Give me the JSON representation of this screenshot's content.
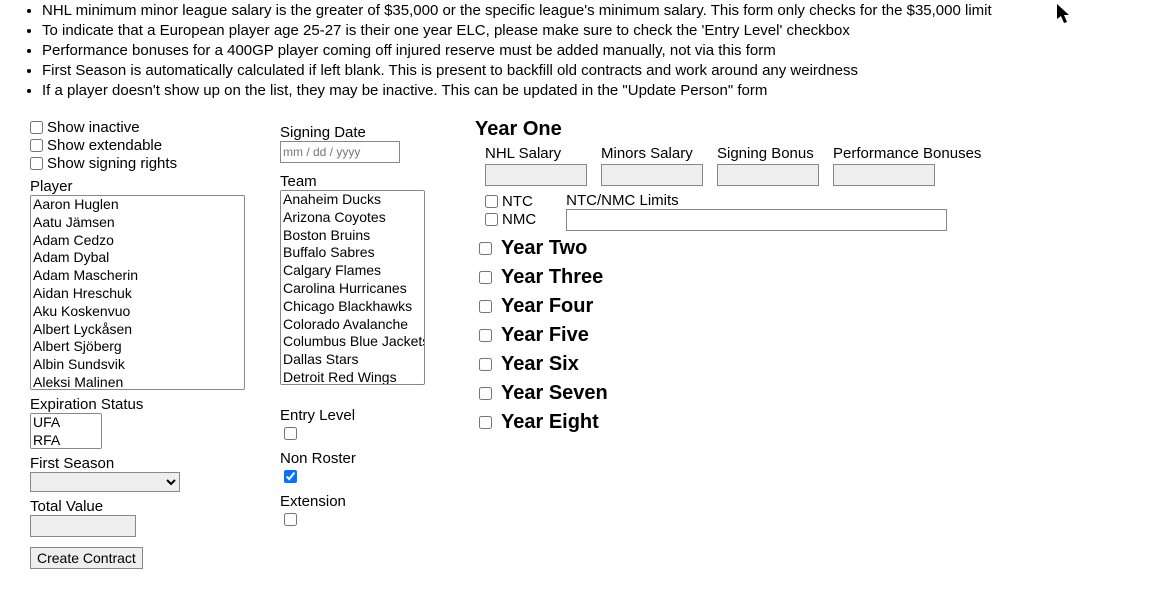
{
  "notes": {
    "n0": "NHL minimum minor league salary is the greater of $35,000 or the specific league's minimum salary. This form only checks for the $35,000 limit",
    "n1": "To indicate that a European player age 25-27 is their one year ELC, please make sure to check the 'Entry Level' checkbox",
    "n2": "Performance bonuses for a 400GP player coming off injured reserve must be added manually, not via this form",
    "n3": "First Season is automatically calculated if left blank. This is present to backfill old contracts and work around any weirdness",
    "n4": "If a player doesn't show up on the list, they may be inactive. This can be updated in the \"Update Person\" form"
  },
  "filters": {
    "show_inactive": "Show inactive",
    "show_extendable": "Show extendable",
    "show_signing_rights": "Show signing rights"
  },
  "labels": {
    "player": "Player",
    "team": "Team",
    "signing_date": "Signing Date",
    "expiration_status": "Expiration Status",
    "first_season": "First Season",
    "total_value": "Total Value",
    "entry_level": "Entry Level",
    "non_roster": "Non Roster",
    "extension": "Extension",
    "create_contract": "Create Contract",
    "ntc": "NTC",
    "nmc": "NMC",
    "ntc_limits": "NTC/NMC Limits",
    "nhl_salary": "NHL Salary",
    "minors_salary": "Minors Salary",
    "signing_bonus": "Signing Bonus",
    "performance_bonuses": "Performance Bonuses"
  },
  "date_placeholder": "mm / dd / yyyy",
  "players": [
    "Aaron Huglen",
    "Aatu Jämsen",
    "Adam Cedzo",
    "Adam Dybal",
    "Adam Mascherin",
    "Aidan Hreschuk",
    "Aku Koskenvuo",
    "Albert Lyckåsen",
    "Albert Sjöberg",
    "Albin Sundsvik",
    "Aleksi Malinen"
  ],
  "teams": [
    "Anaheim Ducks",
    "Arizona Coyotes",
    "Boston Bruins",
    "Buffalo Sabres",
    "Calgary Flames",
    "Carolina Hurricanes",
    "Chicago Blackhawks",
    "Colorado Avalanche",
    "Columbus Blue Jackets",
    "Dallas Stars",
    "Detroit Red Wings"
  ],
  "exp_status": [
    "UFA",
    "RFA"
  ],
  "years": {
    "y1": "Year One",
    "y2": "Year Two",
    "y3": "Year Three",
    "y4": "Year Four",
    "y5": "Year Five",
    "y6": "Year Six",
    "y7": "Year Seven",
    "y8": "Year Eight"
  },
  "checks": {
    "entry_level": false,
    "non_roster": true,
    "extension": false
  }
}
